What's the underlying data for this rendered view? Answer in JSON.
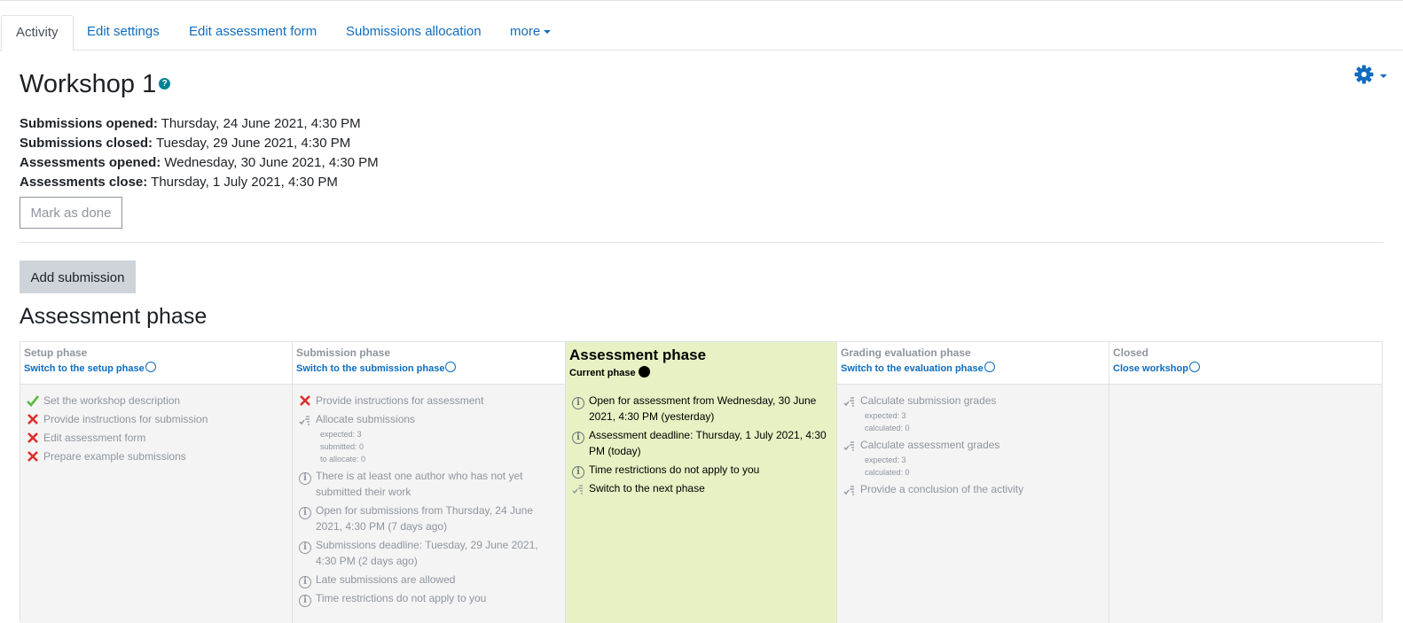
{
  "tabs": [
    {
      "label": "Activity",
      "active": true
    },
    {
      "label": "Edit settings"
    },
    {
      "label": "Edit assessment form"
    },
    {
      "label": "Submissions allocation"
    },
    {
      "label": "more"
    }
  ],
  "page": {
    "title": "Workshop 1",
    "help_glyph": "?"
  },
  "dates": [
    {
      "label": "Submissions opened:",
      "value": "Thursday, 24 June 2021, 4:30 PM"
    },
    {
      "label": "Submissions closed:",
      "value": "Tuesday, 29 June 2021, 4:30 PM"
    },
    {
      "label": "Assessments opened:",
      "value": "Wednesday, 30 June 2021, 4:30 PM"
    },
    {
      "label": "Assessments close:",
      "value": "Thursday, 1 July 2021, 4:30 PM"
    }
  ],
  "buttons": {
    "mark_done": "Mark as done",
    "add_submission": "Add submission"
  },
  "phase_heading": "Assessment phase",
  "colors": {
    "link": "#0f6cbf",
    "current_phase_bg": "#e7f1c3",
    "phase_bg": "#f4f4f4",
    "fail": "#e12b2b",
    "done": "#5ab83c"
  },
  "phases": [
    {
      "title": "Setup phase",
      "link": "Switch to the setup phase",
      "tasks": [
        {
          "icon": "check-icon",
          "text": "Set the workshop description"
        },
        {
          "icon": "cross-icon",
          "text": "Provide instructions for submission"
        },
        {
          "icon": "cross-icon",
          "text": "Edit assessment form"
        },
        {
          "icon": "cross-icon",
          "text": "Prepare example submissions"
        }
      ]
    },
    {
      "title": "Submission phase",
      "link": "Switch to the submission phase",
      "tasks": [
        {
          "icon": "cross-icon",
          "text": "Provide instructions for assessment"
        },
        {
          "icon": "todo-icon",
          "text": "Allocate submissions",
          "details": [
            "expected: 3",
            "submitted: 0",
            "to allocate: 0"
          ]
        },
        {
          "icon": "info-icon",
          "text": "There is at least one author who has not yet submitted their work"
        },
        {
          "icon": "info-icon",
          "text": "Open for submissions from Thursday, 24 June 2021, 4:30 PM (7 days ago)"
        },
        {
          "icon": "info-icon",
          "text": "Submissions deadline: Tuesday, 29 June 2021, 4:30 PM (2 days ago)"
        },
        {
          "icon": "info-icon",
          "text": "Late submissions are allowed"
        },
        {
          "icon": "info-icon",
          "text": "Time restrictions do not apply to you"
        }
      ]
    },
    {
      "title": "Assessment phase",
      "current_label": "Current phase",
      "tasks": [
        {
          "icon": "info-icon",
          "text": "Open for assessment from Wednesday, 30 June 2021, 4:30 PM (yesterday)"
        },
        {
          "icon": "info-icon",
          "text": "Assessment deadline: Thursday, 1 July 2021, 4:30 PM (today)"
        },
        {
          "icon": "info-icon",
          "text": "Time restrictions do not apply to you"
        },
        {
          "icon": "todo-icon",
          "text": "Switch to the next phase"
        }
      ]
    },
    {
      "title": "Grading evaluation phase",
      "link": "Switch to the evaluation phase",
      "tasks": [
        {
          "icon": "todo-icon",
          "text": "Calculate submission grades",
          "details": [
            "expected: 3",
            "calculated: 0"
          ]
        },
        {
          "icon": "todo-icon",
          "text": "Calculate assessment grades",
          "details": [
            "expected: 3",
            "calculated: 0"
          ]
        },
        {
          "icon": "todo-icon",
          "text": "Provide a conclusion of the activity"
        }
      ]
    },
    {
      "title": "Closed",
      "link": "Close workshop",
      "tasks": []
    }
  ]
}
